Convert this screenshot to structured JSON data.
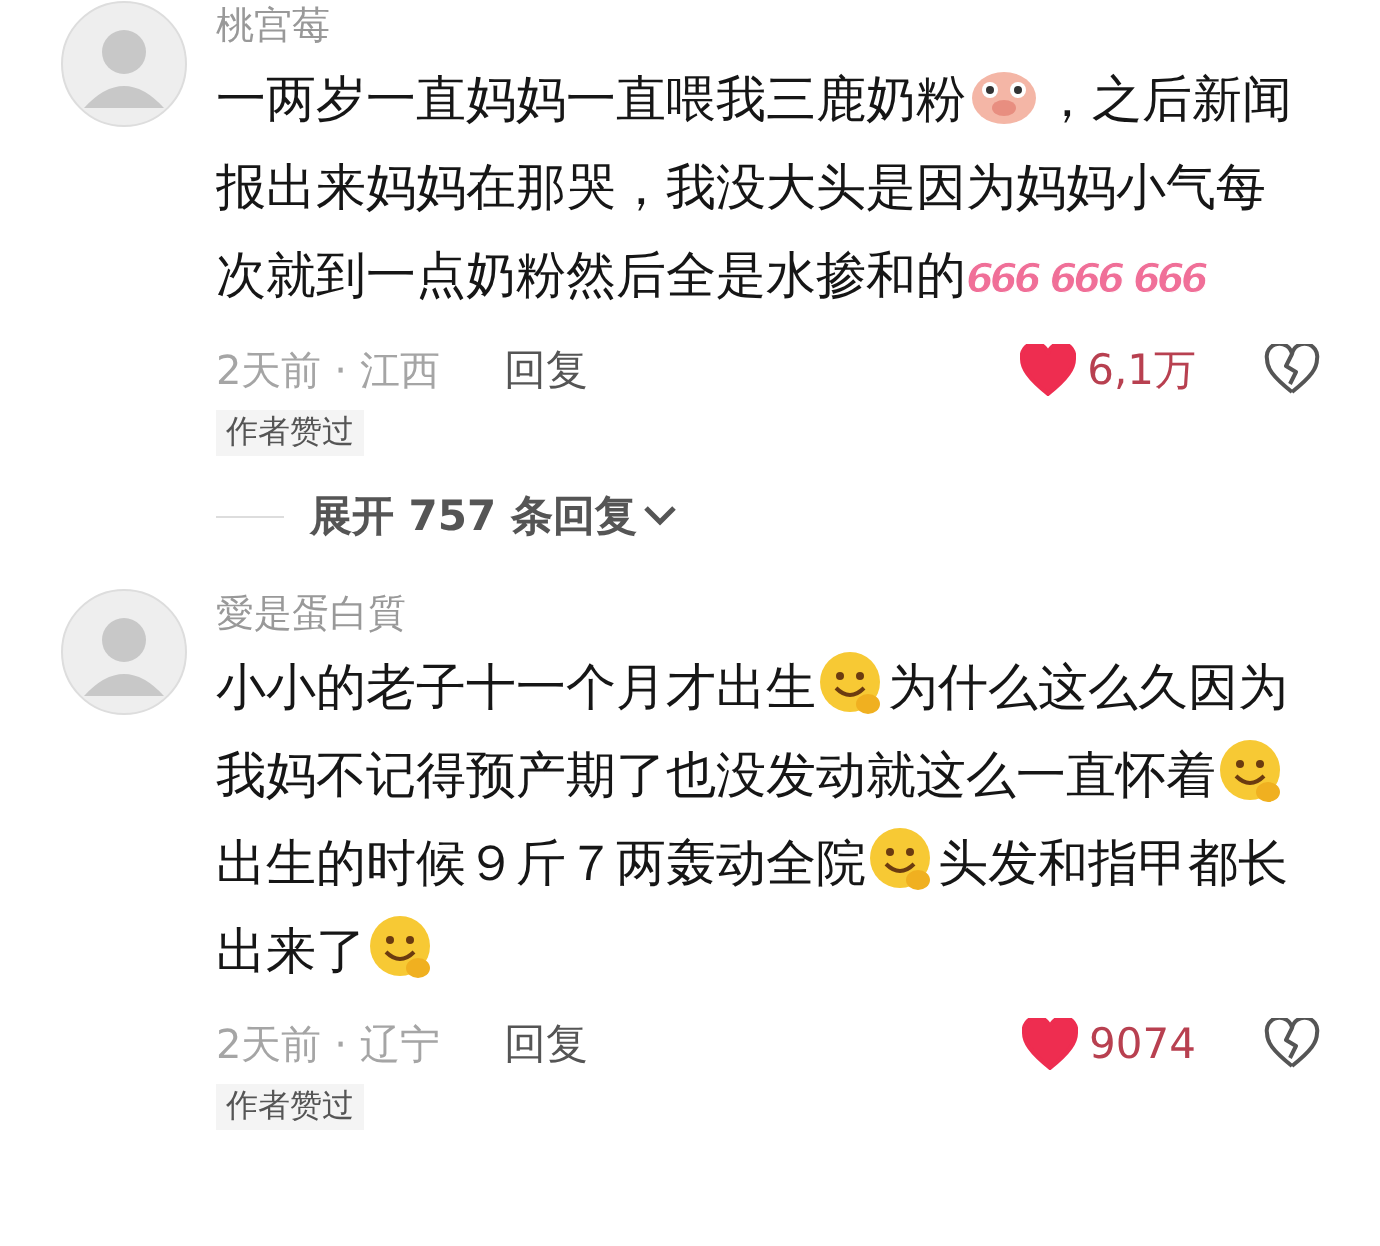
{
  "comments": [
    {
      "user": "桃宫莓",
      "content": [
        {
          "kind": "text",
          "text": "一两岁一直妈妈一直喂我三鹿奶粉"
        },
        {
          "kind": "pig"
        },
        {
          "kind": "text",
          "text": "，之后新闻报出来妈妈在那哭，我没大头是因为妈妈小气每次就到一点奶粉然后全是水掺和的"
        },
        {
          "kind": "sticker",
          "text": "666"
        },
        {
          "kind": "sticker",
          "text": "666"
        },
        {
          "kind": "sticker",
          "text": "666"
        }
      ],
      "meta": "2天前 · 江西",
      "reply": "回复",
      "liked": true,
      "likes": "6,1万",
      "badge": "作者赞过",
      "expand": "展开 757 条回复"
    },
    {
      "user": "愛是蛋白質",
      "content": [
        {
          "kind": "text",
          "text": "小小的老子十一个月才出生"
        },
        {
          "kind": "smile"
        },
        {
          "kind": "text",
          "text": "为什么这么久因为我妈不记得预产期了也没发动就这么一直怀着"
        },
        {
          "kind": "smile"
        },
        {
          "kind": "text",
          "text": "出生的时候９斤７两轰动全院"
        },
        {
          "kind": "smile"
        },
        {
          "kind": "text",
          "text": "头发和指甲都长出来了"
        },
        {
          "kind": "smile"
        }
      ],
      "meta": "2天前 · 辽宁",
      "reply": "回复",
      "liked": true,
      "likes": "9074",
      "badge": "作者赞过"
    }
  ]
}
